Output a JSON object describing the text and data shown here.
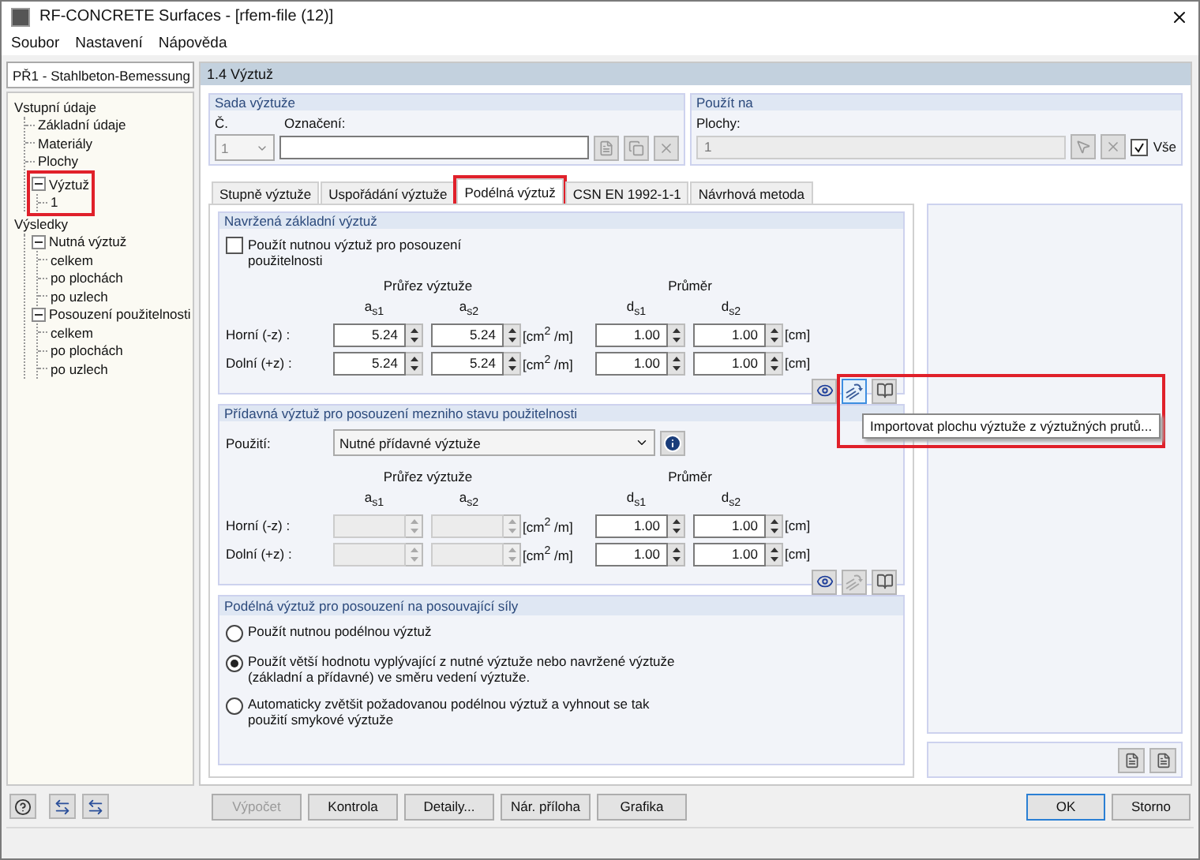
{
  "window": {
    "title": "RF-CONCRETE Surfaces - [rfem-file (12)]"
  },
  "menu": [
    "Soubor",
    "Nastavení",
    "Nápověda"
  ],
  "case_select": {
    "value": "PŘ1 - Stahlbeton-Bemessung"
  },
  "tree": [
    {
      "label": "Vstupní údaje",
      "kind": "root",
      "children": [
        {
          "label": "Základní údaje"
        },
        {
          "label": "Materiály"
        },
        {
          "label": "Plochy"
        },
        {
          "label": "Výztuž",
          "kind": "node",
          "expanded": true,
          "highlighted": true,
          "children": [
            {
              "label": "1"
            }
          ]
        }
      ]
    },
    {
      "label": "Výsledky",
      "kind": "root",
      "children": [
        {
          "label": "Nutná výztuž",
          "kind": "node",
          "expanded": true,
          "highlighted": false,
          "children": [
            {
              "label": "celkem"
            },
            {
              "label": "po plochách"
            },
            {
              "label": "po uzlech"
            }
          ]
        },
        {
          "label": "Posouzení použitelnosti",
          "kind": "node",
          "expanded": true,
          "highlighted": false,
          "children": [
            {
              "label": "celkem"
            },
            {
              "label": "po plochách"
            },
            {
              "label": "po uzlech"
            }
          ]
        }
      ]
    }
  ],
  "page_header": "1.4 Výztuž",
  "set_group": {
    "title": "Sada výztuže",
    "number_label": "Č.",
    "number": "1",
    "name_label": "Označení:"
  },
  "apply_group": {
    "title": "Použít na",
    "label": "Plochy:",
    "value": "1",
    "all_label": "Vše",
    "all_checked": true
  },
  "tabs": [
    {
      "label": "Stupně výztuže",
      "selected": false,
      "highlighted": false
    },
    {
      "label": "Uspořádání výztuže",
      "selected": false,
      "highlighted": false
    },
    {
      "label": "Podélná výztuž",
      "selected": true,
      "highlighted": true
    },
    {
      "label": "CSN EN 1992-1-1",
      "selected": false,
      "highlighted": false
    },
    {
      "label": "Návrhová metoda",
      "selected": false,
      "highlighted": false
    }
  ],
  "sections": [
    {
      "kind": "bars",
      "title": "Navržená základní výztuž",
      "checkbox": {
        "label": "Použít nutnou výztuž pro posouzení použitelnosti",
        "checked": false
      },
      "area_heading": "Průřez výztuže",
      "diameter_heading": "Průměr",
      "columns": [
        "a$_{s1}$",
        "a$_{s2}$",
        "d$_{s1}$",
        "d$_{s2}$"
      ],
      "rows": [
        {
          "label": "Horní (-z) :",
          "as1": "5.24",
          "as2": "5.24",
          "area_unit": "[cm$^{2}$ /m]",
          "ds1": "1.00",
          "ds2": "1.00",
          "dia_unit": "[cm]",
          "area_disabled": false
        },
        {
          "label": "Dolní (+z) :",
          "as1": "5.24",
          "as2": "5.24",
          "area_unit": "[cm$^{2}$ /m]",
          "ds1": "1.00",
          "ds2": "1.00",
          "dia_unit": "[cm]",
          "area_disabled": false
        }
      ],
      "import_disabled": false,
      "import_highlighted": true,
      "tooltip": "Importovat plochu výztuže z výztužných prutů..."
    },
    {
      "kind": "bars",
      "title": "Přídavná výztuž pro posouzení mezniho stavu použitelnosti",
      "usage": {
        "label": "Použití:",
        "value": "Nutné přídavné výztuže"
      },
      "area_heading": "Průřez výztuže",
      "diameter_heading": "Průměr",
      "columns": [
        "a$_{s1}$",
        "a$_{s2}$",
        "d$_{s1}$",
        "d$_{s2}$"
      ],
      "rows": [
        {
          "label": "Horní (-z) :",
          "area_unit": "[cm$^{2}$ /m]",
          "ds1": "1.00",
          "ds2": "1.00",
          "dia_unit": "[cm]",
          "area_disabled": true
        },
        {
          "label": "Dolní (+z) :",
          "area_unit": "[cm$^{2}$ /m]",
          "ds1": "1.00",
          "ds2": "1.00",
          "dia_unit": "[cm]",
          "area_disabled": true
        }
      ],
      "import_disabled": true,
      "import_highlighted": false
    },
    {
      "kind": "options",
      "title": "Podélná výztuž pro posouzení na posouvající síly",
      "options": [
        {
          "label": "Použít nutnou podélnou výztuž",
          "selected": false
        },
        {
          "label": "Použít větší hodnotu vyplývající z nutné výztuže nebo navržené výztuže (základní a přídavné) ve směru vedení výztuže.",
          "selected": true
        },
        {
          "label": "Automaticky zvětšit požadovanou podélnou výztuž a vyhnout se tak použití smykové výztuže",
          "selected": false
        }
      ]
    }
  ],
  "footer_buttons": [
    {
      "label": "Výpočet",
      "disabled": true
    },
    {
      "label": "Kontrola",
      "disabled": false
    },
    {
      "label": "Detaily...",
      "disabled": false
    },
    {
      "label": "Nár. příloha",
      "disabled": false
    },
    {
      "label": "Grafika",
      "disabled": false
    }
  ],
  "dialog_buttons": [
    {
      "label": "OK",
      "default": true
    },
    {
      "label": "Storno",
      "default": false
    }
  ]
}
